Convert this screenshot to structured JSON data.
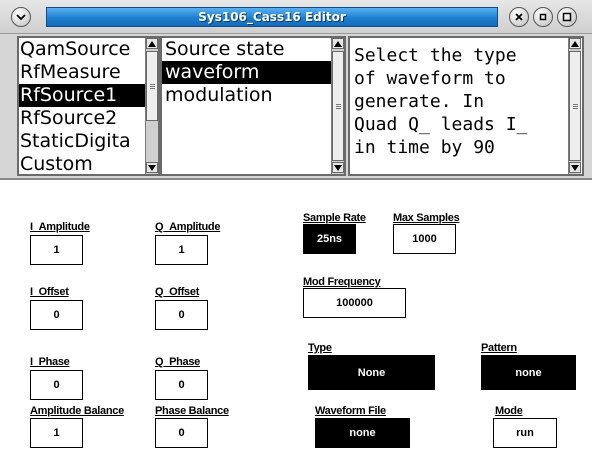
{
  "window": {
    "title": "Sys106_Cass16 Editor",
    "menu_icon": "chevron-down-icon",
    "close_icon": "close-icon",
    "minimize_icon": "minimize-icon",
    "maximize_icon": "maximize-icon"
  },
  "objects_list": {
    "items": [
      "QamSource",
      "RfMeasure",
      "RfSource1",
      "RfSource2",
      "StaticDigita",
      "Custom"
    ],
    "selected_index": 2
  },
  "properties_list": {
    "items": [
      "Source state",
      "waveform",
      "modulation"
    ],
    "selected_index": 1
  },
  "description": {
    "lines": [
      "Select the type",
      "of waveform to",
      "generate.  In",
      "Quad Q_ leads I_",
      "in time by 90"
    ]
  },
  "form": {
    "i_amplitude": {
      "label": "I_Amplitude",
      "value": "1"
    },
    "q_amplitude": {
      "label": "Q_Amplitude",
      "value": "1"
    },
    "i_offset": {
      "label": "I_Offset",
      "value": "0"
    },
    "q_offset": {
      "label": "Q_Offset",
      "value": "0"
    },
    "i_phase": {
      "label": "I_Phase",
      "value": "0"
    },
    "q_phase": {
      "label": "Q_Phase",
      "value": "0"
    },
    "amplitude_balance": {
      "label": "Amplitude Balance",
      "value": "1"
    },
    "phase_balance": {
      "label": "Phase Balance",
      "value": "0"
    },
    "sample_rate": {
      "label": "Sample Rate",
      "value": "25ns"
    },
    "max_samples": {
      "label": "Max Samples",
      "value": "1000"
    },
    "mod_frequency": {
      "label": "Mod Frequency",
      "value": "100000"
    },
    "type": {
      "label": "Type",
      "value": "None"
    },
    "pattern": {
      "label": "Pattern",
      "value": "none"
    },
    "waveform_file": {
      "label": "Waveform File",
      "value": "none"
    },
    "mode": {
      "label": "Mode",
      "value": "run"
    }
  }
}
